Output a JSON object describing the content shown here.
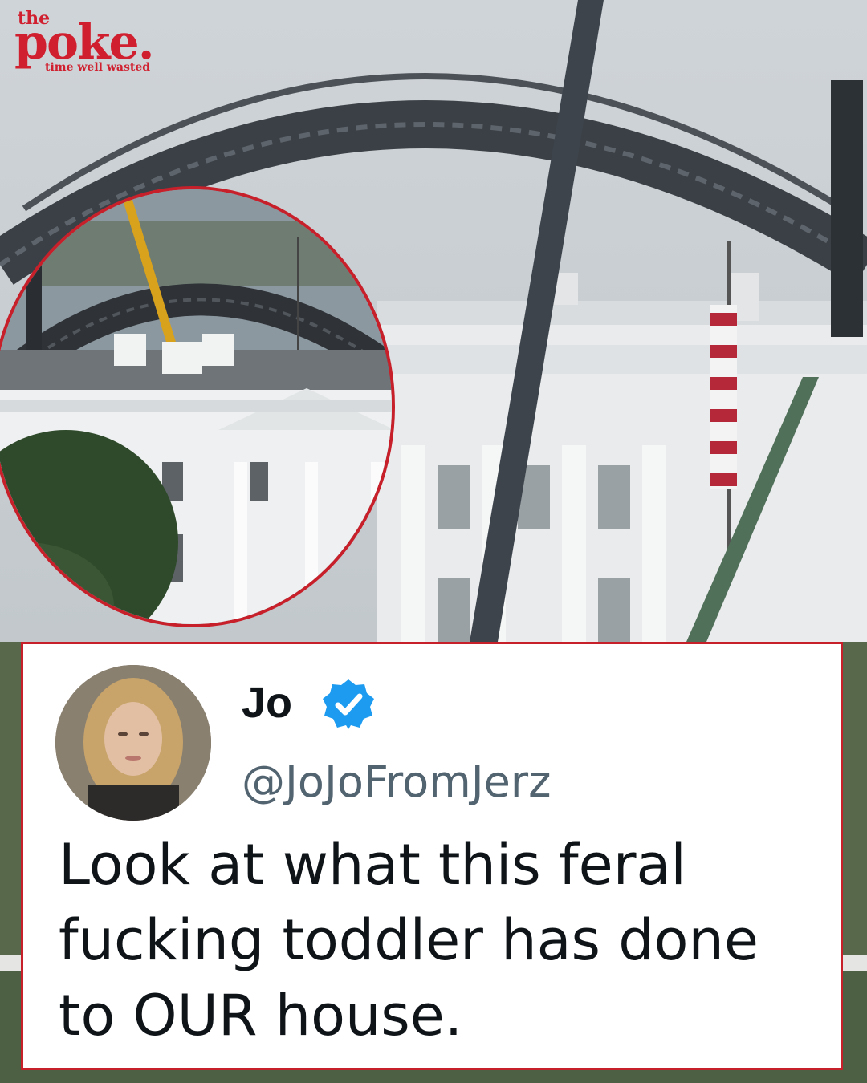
{
  "brand": {
    "small": "the",
    "name": "poke.",
    "tagline": "time well wasted",
    "color": "#d01f2e"
  },
  "tweet": {
    "display_name": "Jo",
    "handle": "@JoJoFromJerz",
    "verified_icon": "verified-badge-icon",
    "text": "Look at what this feral fucking toddler has done to OUR house.",
    "accent_color": "#1d9bf0"
  },
  "frame_color": "#c8202b"
}
